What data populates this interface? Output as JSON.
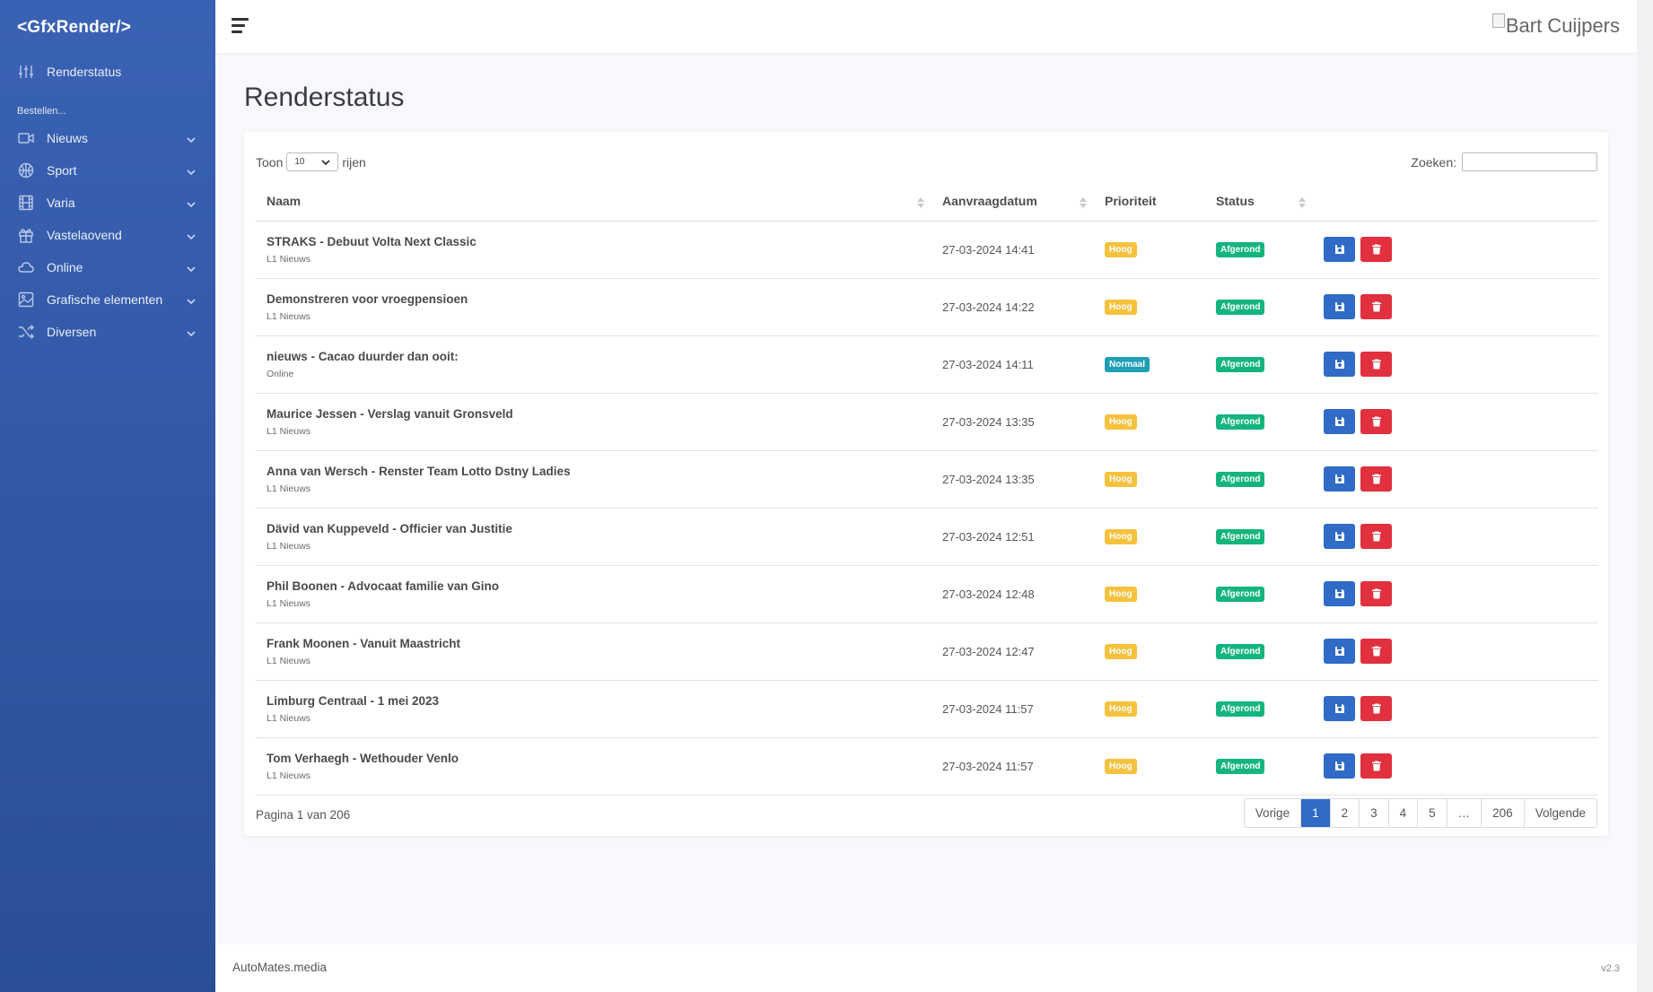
{
  "sidebar": {
    "brand": "<GfxRender/>",
    "top_item": "Renderstatus",
    "section_label": "Bestellen...",
    "items": [
      {
        "label": "Nieuws",
        "icon": "video-icon"
      },
      {
        "label": "Sport",
        "icon": "basketball-icon"
      },
      {
        "label": "Varia",
        "icon": "film-icon"
      },
      {
        "label": "Vastelaovend",
        "icon": "gift-icon"
      },
      {
        "label": "Online",
        "icon": "cloud-icon"
      },
      {
        "label": "Grafische elementen",
        "icon": "image-icon"
      },
      {
        "label": "Diversen",
        "icon": "shuffle-icon"
      }
    ]
  },
  "topbar": {
    "user_name": "Bart Cuijpers"
  },
  "page": {
    "title": "Renderstatus"
  },
  "table_controls": {
    "show_label": "Toon",
    "show_value": "10",
    "rows_label": "rijen",
    "search_label": "Zoeken:",
    "search_value": ""
  },
  "columns": [
    "Naam",
    "Aanvraagdatum",
    "Prioriteit",
    "Status"
  ],
  "rows": [
    {
      "name": "STRAKS - Debuut Volta Next Classic",
      "sub": "L1 Nieuws",
      "date": "27-03-2024 14:41",
      "priority": "Hoog",
      "status": "Afgerond"
    },
    {
      "name": "Demonstreren voor vroegpensioen",
      "sub": "L1 Nieuws",
      "date": "27-03-2024 14:22",
      "priority": "Hoog",
      "status": "Afgerond"
    },
    {
      "name": "nieuws - Cacao duurder dan ooit:",
      "sub": "Online",
      "date": "27-03-2024 14:11",
      "priority": "Normaal",
      "status": "Afgerond"
    },
    {
      "name": "Maurice Jessen - Verslag vanuit Gronsveld",
      "sub": "L1 Nieuws",
      "date": "27-03-2024 13:35",
      "priority": "Hoog",
      "status": "Afgerond"
    },
    {
      "name": "Anna van Wersch - Renster Team Lotto Dstny Ladies",
      "sub": "L1 Nieuws",
      "date": "27-03-2024 13:35",
      "priority": "Hoog",
      "status": "Afgerond"
    },
    {
      "name": "Dävid van Kuppeveld - Officier van Justitie",
      "sub": "L1 Nieuws",
      "date": "27-03-2024 12:51",
      "priority": "Hoog",
      "status": "Afgerond"
    },
    {
      "name": "Phil Boonen - Advocaat familie van Gino",
      "sub": "L1 Nieuws",
      "date": "27-03-2024 12:48",
      "priority": "Hoog",
      "status": "Afgerond"
    },
    {
      "name": "Frank Moonen - Vanuit Maastricht",
      "sub": "L1 Nieuws",
      "date": "27-03-2024 12:47",
      "priority": "Hoog",
      "status": "Afgerond"
    },
    {
      "name": "Limburg Centraal - 1 mei 2023",
      "sub": "L1 Nieuws",
      "date": "27-03-2024 11:57",
      "priority": "Hoog",
      "status": "Afgerond"
    },
    {
      "name": "Tom Verhaegh - Wethouder Venlo",
      "sub": "L1 Nieuws",
      "date": "27-03-2024 11:57",
      "priority": "Hoog",
      "status": "Afgerond"
    }
  ],
  "pagination": {
    "info": "Pagina 1 van 206",
    "prev": "Vorige",
    "pages": [
      "1",
      "2",
      "3",
      "4",
      "5",
      "…",
      "206"
    ],
    "active": "1",
    "next": "Volgende"
  },
  "footer": {
    "company": "AutoMates.media",
    "version": "v2.3"
  },
  "colors": {
    "sidebar": "#3a62b4",
    "priority_high": "#f6c23e",
    "priority_normal": "#1e9fb5",
    "status_done": "#14b57c",
    "save_button": "#2f6bc7",
    "delete_button": "#e1303e"
  }
}
